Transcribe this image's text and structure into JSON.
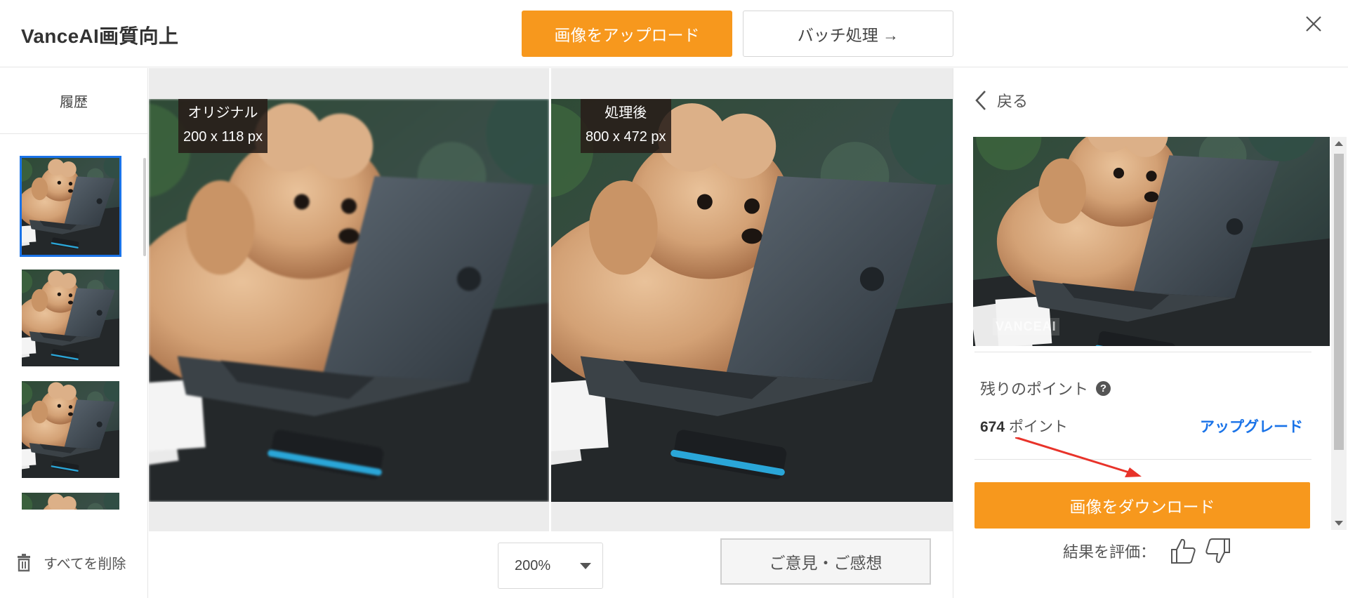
{
  "header": {
    "brand": "VanceAI画質向上",
    "upload_label": "画像をアップロード",
    "batch_label": "バッチ処理 →"
  },
  "sidebar": {
    "title": "履歴",
    "delete_all_label": "すべてを削除"
  },
  "compare": {
    "original": {
      "label": "オリジナル",
      "size": "200 x 118 px"
    },
    "processed": {
      "label": "処理後",
      "size": "800 x 472 px"
    }
  },
  "zoom": {
    "value": "200%"
  },
  "feedback_label": "ご意見・ご感想",
  "right_panel": {
    "back_label": "戻る",
    "watermark": "VANCEAI",
    "points_label": "残りのポイント",
    "points_value": "674",
    "points_unit": " ポイント",
    "upgrade_label": "アップグレード",
    "download_label": "画像をダウンロード",
    "rate_label": "結果を評価："
  },
  "colors": {
    "accent": "#f7981d",
    "link": "#1a73e8",
    "annotation_arrow": "#e8332a"
  }
}
